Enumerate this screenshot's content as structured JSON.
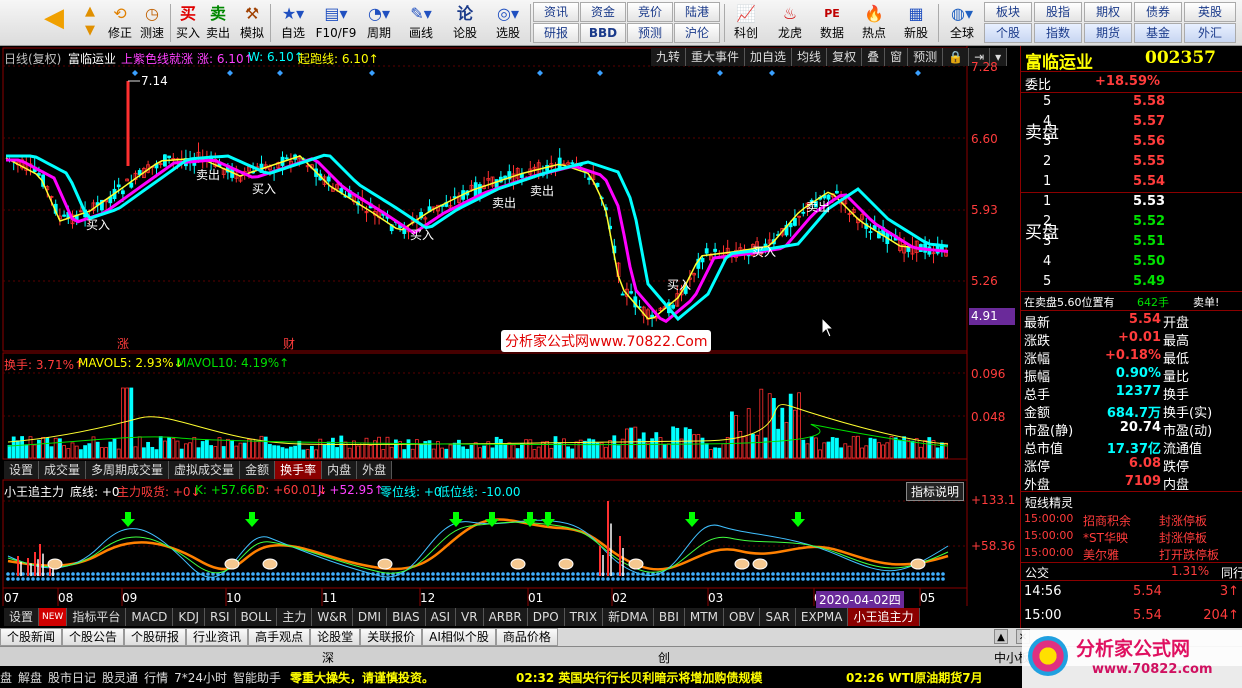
{
  "toolbar": {
    "nav": [
      "修正",
      "测速"
    ],
    "buttons": [
      "买入",
      "卖出",
      "模拟",
      "自选",
      "F10/F9",
      "周期",
      "画线",
      "论股",
      "选股"
    ],
    "grid1": [
      "资讯",
      "资金",
      "竞价",
      "陆港",
      "研报",
      "BBD",
      "预测",
      "沪伦"
    ],
    "big": [
      "科创",
      "龙虎",
      "数据",
      "热点",
      "新股",
      "全球"
    ],
    "grid2": [
      "板块",
      "股指",
      "期权",
      "债券",
      "英股",
      "个股",
      "指数",
      "期货",
      "基金",
      "外汇"
    ]
  },
  "header": {
    "period": "日线(复权)",
    "name": "富临运业",
    "ind_label": "上紫色线就涨",
    "ind_zhang": "涨: 6.10↑",
    "ind_w": "W: 6.10↑",
    "ind_qpx": "起跑线: 6.10↑",
    "buttons": [
      "九转",
      "重大事件",
      "加自选",
      "均线",
      "复权",
      "叠",
      "窗",
      "预测"
    ]
  },
  "price_axis": [
    "7.28",
    "6.60",
    "5.93",
    "5.26",
    "4.91"
  ],
  "annot": {
    "high": "7.14",
    "zhang": "涨",
    "cai": "财",
    "watermark": "分析家公式网www.70822.Com",
    "buy": "买入",
    "sell": "卖出"
  },
  "volume": {
    "title": "换手: 3.71%↑",
    "ma5": "MAVOL5: 2.93%↓",
    "ma10": "MAVOL10: 4.19%↑",
    "axis": [
      "0.096",
      "0.048"
    ]
  },
  "vtabs": [
    "设置",
    "成交量",
    "多周期成交量",
    "虚拟成交量",
    "金额",
    "换手率",
    "内盘",
    "外盘"
  ],
  "ind": {
    "name": "小王追主力",
    "dixian": "底线: +0",
    "zhuli": "主力吸货: +0↓",
    "k": "K: +57.66↑",
    "d": "D: +60.01↓",
    "j": "J: +52.95↑",
    "zero": "零位线: +0",
    "low": "低位线: -10.00",
    "explain": "指标说明",
    "axis": [
      "+133.1",
      "+58.36"
    ]
  },
  "dates": [
    "07",
    "08",
    "09",
    "10",
    "11",
    "12",
    "01",
    "02",
    "03",
    "04",
    "05"
  ],
  "date_cursor": "2020-04-02四",
  "itabs": [
    "设置",
    "NEW",
    "指标平台",
    "MACD",
    "KDJ",
    "RSI",
    "BOLL",
    "主力",
    "W&R",
    "DMI",
    "BIAS",
    "ASI",
    "VR",
    "ARBR",
    "DPO",
    "TRIX",
    "新DMA",
    "BBI",
    "MTM",
    "OBV",
    "SAR",
    "EXPMA",
    "小王追主力"
  ],
  "stock": {
    "name": "富临运业",
    "code": "002357"
  },
  "weibi": {
    "label": "委比",
    "value": "+18.59%"
  },
  "sell_label": "卖盘",
  "buy_label": "买盘",
  "sells": [
    {
      "n": "5",
      "p": "5.58"
    },
    {
      "n": "4",
      "p": "5.57"
    },
    {
      "n": "3",
      "p": "5.56"
    },
    {
      "n": "2",
      "p": "5.55"
    },
    {
      "n": "1",
      "p": "5.54"
    }
  ],
  "buys": [
    {
      "n": "1",
      "p": "5.53"
    },
    {
      "n": "2",
      "p": "5.52"
    },
    {
      "n": "3",
      "p": "5.51"
    },
    {
      "n": "4",
      "p": "5.50"
    },
    {
      "n": "5",
      "p": "5.49"
    }
  ],
  "notice": {
    "text": "在卖盘5.60位置有",
    "vol": "642手",
    "tag": "卖单!"
  },
  "quote": [
    {
      "l": "最新",
      "v": "5.54",
      "l2": "开盘"
    },
    {
      "l": "涨跌",
      "v": "+0.01",
      "l2": "最高"
    },
    {
      "l": "涨幅",
      "v": "+0.18%",
      "l2": "最低"
    },
    {
      "l": "振幅",
      "v": "0.90%",
      "l2": "量比"
    },
    {
      "l": "总手",
      "v": "12377",
      "l2": "换手"
    },
    {
      "l": "金额",
      "v": "684.7万",
      "l2": "换手(实)"
    },
    {
      "l": "市盈(静)",
      "v": "20.74",
      "l2": "市盈(动)"
    },
    {
      "l": "总市值",
      "v": "17.37亿",
      "l2": "流通值"
    },
    {
      "l": "涨停",
      "v": "6.08",
      "l2": "跌停"
    },
    {
      "l": "外盘",
      "v": "7109",
      "l2": "内盘"
    }
  ],
  "duanxian": {
    "title": "短线精灵",
    "rows": [
      {
        "t": "15:00:00",
        "n": "招商积余",
        "e": "封涨停板"
      },
      {
        "t": "15:00:00",
        "n": "*ST华映",
        "e": "封涨停板"
      },
      {
        "t": "15:00:00",
        "n": "美尔雅",
        "e": "打开跌停板"
      }
    ]
  },
  "gongjiao": {
    "label": "公交",
    "pct": "1.31%",
    "tag": "同行"
  },
  "ticks": [
    {
      "t": "14:56",
      "p": "5.54",
      "v": "3↑"
    },
    {
      "t": "15:00",
      "p": "5.54",
      "v": "204↑"
    }
  ],
  "btabs": [
    "个股新闻",
    "个股公告",
    "个股研报",
    "行业资讯",
    "高手观点",
    "论股堂",
    "关联报价",
    "AI相似个股",
    "商品价格"
  ],
  "bar2": {
    "shen": "深",
    "chuang": "创",
    "zx": "中小板"
  },
  "status": [
    "盘",
    "解盘",
    "股市日记",
    "股灵通",
    "行情",
    "7*24小时",
    "智能助手"
  ],
  "news": [
    "零重大操失，请谨慎投资。",
    "02:32 英国央行行长贝利暗示将增加购债规模",
    "02:26 WTI原油期货7月"
  ],
  "brand": {
    "name": "分析家公式网",
    "url": "www.70822.com"
  },
  "colors": {
    "ma_cyan": "#00ffff",
    "ma_magenta": "#ff00ff",
    "ma_yellow": "#ffff30",
    "up": "#ff3030",
    "down": "#00ffff"
  }
}
